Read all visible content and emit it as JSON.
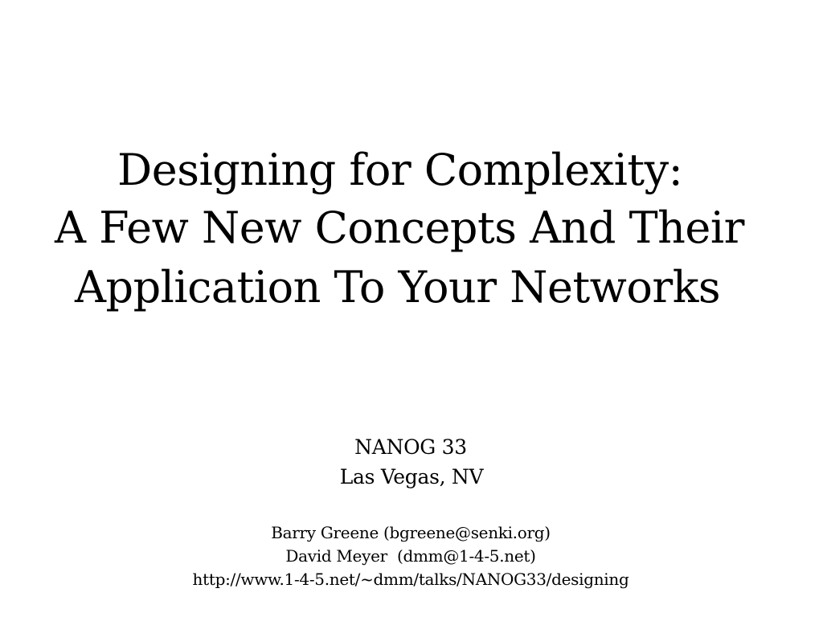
{
  "slide": {
    "title_lines": [
      "Designing for Complexity:",
      "A Few New Concepts And Their",
      "Application To Your Networks"
    ],
    "event": {
      "name": "NANOG 33",
      "location": "Las Vegas, NV"
    },
    "authors": [
      "Barry Greene (bgreene@senki.org)",
      "David Meyer  (dmm@1-4-5.net)"
    ],
    "url": "http://www.1-4-5.net/~dmm/talks/NANOG33/designing"
  }
}
